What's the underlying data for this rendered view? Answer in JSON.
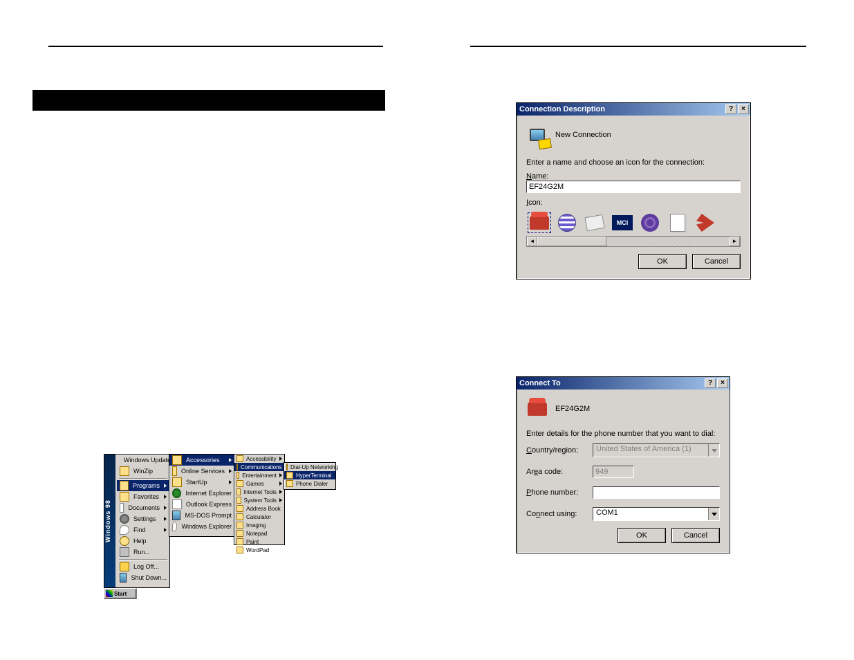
{
  "dialogs": {
    "conn_desc": {
      "title": "Connection Description",
      "title_help": "?",
      "title_close": "×",
      "header": "New Connection",
      "prompt": "Enter a name and choose an icon for the connection:",
      "name_label": "Name:",
      "name_value": "EF24G2M",
      "icon_label": "Icon:",
      "icon_names": [
        "phone-icon",
        "globe-icon",
        "modem-icon",
        "mci-icon",
        "att-icon",
        "document-icon",
        "satellite-icon"
      ],
      "mci_text": "MCI",
      "scroll_left": "◄",
      "scroll_right": "►",
      "ok": "OK",
      "cancel": "Cancel"
    },
    "connect_to": {
      "title": "Connect To",
      "title_help": "?",
      "title_close": "×",
      "conn_name": "EF24G2M",
      "prompt": "Enter details for the phone number that you want to dial:",
      "country_label": "Country/region:",
      "country_value": "United States of America (1)",
      "area_label": "Area code:",
      "area_value": "949",
      "phone_label": "Phone number:",
      "phone_value": "",
      "connect_label": "Connect using:",
      "connect_value": "COM1",
      "ok": "OK",
      "cancel": "Cancel"
    }
  },
  "start_menu": {
    "band": "Windows 98",
    "col1": [
      {
        "label": "Windows Update",
        "hl": false,
        "arrow": false,
        "icon": "globe"
      },
      {
        "label": "WinZip",
        "hl": false,
        "arrow": false,
        "icon": "folder"
      },
      {
        "label": "Programs",
        "hl": true,
        "arrow": true,
        "icon": "folder"
      },
      {
        "label": "Favorites",
        "hl": false,
        "arrow": true,
        "icon": "folder"
      },
      {
        "label": "Documents",
        "hl": false,
        "arrow": true,
        "icon": "doc"
      },
      {
        "label": "Settings",
        "hl": false,
        "arrow": true,
        "icon": "gear"
      },
      {
        "label": "Find",
        "hl": false,
        "arrow": true,
        "icon": "find"
      },
      {
        "label": "Help",
        "hl": false,
        "arrow": false,
        "icon": "help"
      },
      {
        "label": "Run...",
        "hl": false,
        "arrow": false,
        "icon": "run"
      },
      {
        "label": "Log Off...",
        "hl": false,
        "arrow": false,
        "icon": "key"
      },
      {
        "label": "Shut Down...",
        "hl": false,
        "arrow": false,
        "icon": "mon"
      }
    ],
    "col2": [
      {
        "label": "Accessories",
        "hl": true,
        "arrow": true,
        "icon": "folder"
      },
      {
        "label": "Online Services",
        "hl": false,
        "arrow": true,
        "icon": "folder"
      },
      {
        "label": "StartUp",
        "hl": false,
        "arrow": true,
        "icon": "folder"
      },
      {
        "label": "Internet Explorer",
        "hl": false,
        "arrow": false,
        "icon": "globe"
      },
      {
        "label": "Outlook Express",
        "hl": false,
        "arrow": false,
        "icon": "doc"
      },
      {
        "label": "MS-DOS Prompt",
        "hl": false,
        "arrow": false,
        "icon": "mon"
      },
      {
        "label": "Windows Explorer",
        "hl": false,
        "arrow": false,
        "icon": "find"
      }
    ],
    "col3": [
      {
        "label": "Accessibility",
        "hl": false,
        "arrow": true
      },
      {
        "label": "Communications",
        "hl": true,
        "arrow": true
      },
      {
        "label": "Entertainment",
        "hl": false,
        "arrow": true
      },
      {
        "label": "Games",
        "hl": false,
        "arrow": true
      },
      {
        "label": "Internet Tools",
        "hl": false,
        "arrow": true
      },
      {
        "label": "System Tools",
        "hl": false,
        "arrow": true
      },
      {
        "label": "Address Book",
        "hl": false,
        "arrow": false
      },
      {
        "label": "Calculator",
        "hl": false,
        "arrow": false
      },
      {
        "label": "Imaging",
        "hl": false,
        "arrow": false
      },
      {
        "label": "Notepad",
        "hl": false,
        "arrow": false
      },
      {
        "label": "Paint",
        "hl": false,
        "arrow": false
      },
      {
        "label": "WordPad",
        "hl": false,
        "arrow": false
      }
    ],
    "col4": [
      {
        "label": "Dial-Up Networking",
        "hl": false
      },
      {
        "label": "HyperTerminal",
        "hl": true
      },
      {
        "label": "Phone Dialer",
        "hl": false
      }
    ],
    "taskbar": "Start"
  }
}
